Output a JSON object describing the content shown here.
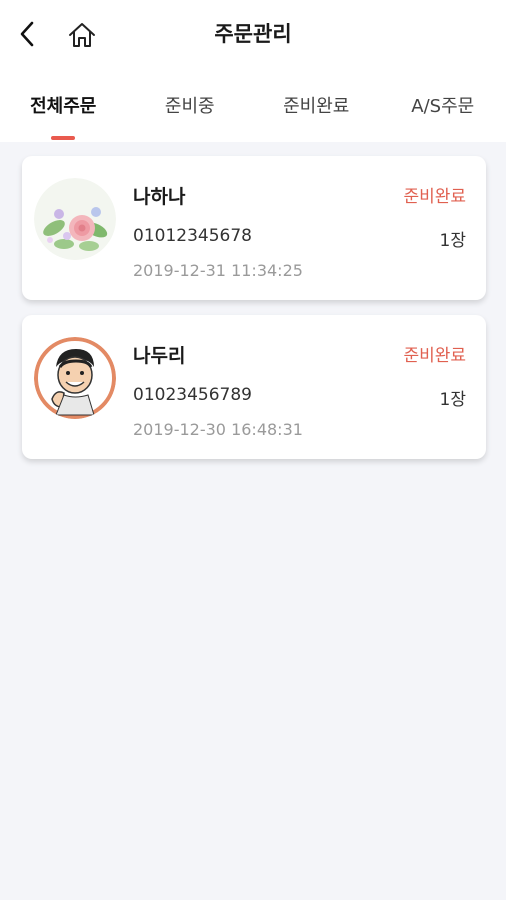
{
  "header": {
    "title": "주문관리",
    "back_icon": "chevron-left-icon",
    "home_icon": "home-icon"
  },
  "tabs": [
    {
      "label": "전체주문",
      "active": true
    },
    {
      "label": "준비중",
      "active": false
    },
    {
      "label": "준비완료",
      "active": false
    },
    {
      "label": "A/S주문",
      "active": false
    }
  ],
  "orders": [
    {
      "name": "나하나",
      "status": "준비완료",
      "phone": "01012345678",
      "quantity": "1장",
      "datetime": "2019-12-31 11:34:25",
      "avatar": "flower-bouquet-avatar"
    },
    {
      "name": "나두리",
      "status": "준비완료",
      "phone": "01023456789",
      "quantity": "1장",
      "datetime": "2019-12-30 16:48:31",
      "avatar": "cartoon-man-avatar"
    }
  ],
  "colors": {
    "accent": "#e95a4e",
    "status_text": "#e06050",
    "background": "#f4f5f9"
  }
}
